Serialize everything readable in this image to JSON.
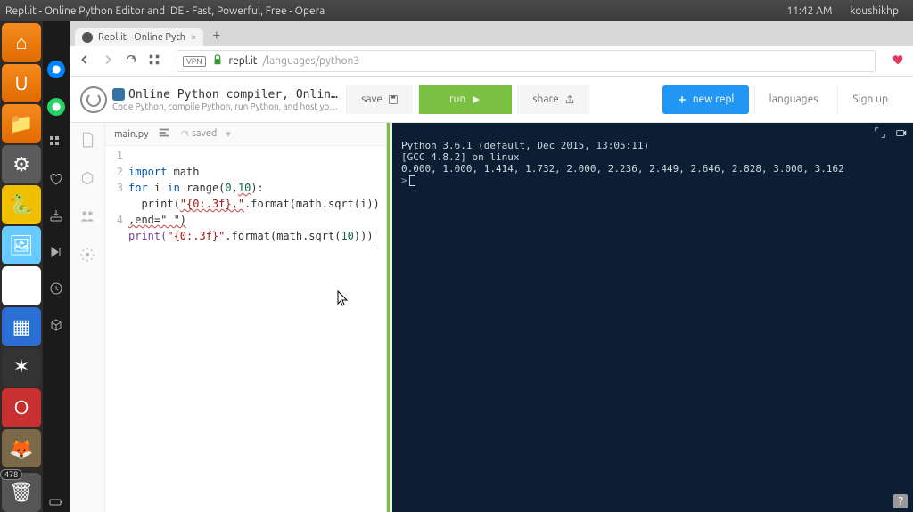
{
  "sysbar": {
    "window_title": "Repl.it - Online Python Editor and IDE - Fast, Powerful, Free - Opera",
    "clock": "11:42 AM",
    "user": "koushikhp"
  },
  "launcher": {
    "badge_count": "478"
  },
  "browser": {
    "tab_title": "Repl.it - Online Pyth",
    "url_host": "repl.it",
    "url_path": "/languages/python3"
  },
  "page": {
    "title_line": "Online Python compiler, Online Python IDE, an…",
    "subtitle": "Code Python, compile Python, run Python, and host your programs and app…",
    "buttons": {
      "save": "save",
      "run": "run",
      "share": "share",
      "newrepl": "new repl",
      "languages": "languages",
      "signup": "Sign up"
    }
  },
  "filebar": {
    "filename": "main.py",
    "saved_label": "saved"
  },
  "code": {
    "lines": [
      "1",
      "2",
      "3",
      "4"
    ],
    "l1_a": "import",
    "l1_b": " math",
    "l2_a": "for",
    "l2_b": " i ",
    "l2_c": "in",
    "l2_d": " range(",
    "l2_e": "0",
    "l2_f": ",",
    "l2_g": "10",
    "l2_h": "):",
    "l3_a": "  print(",
    "l3_b": "\"{0:.3f},\"",
    "l3_c": ".format(math.sqrt(i))",
    "l3_w": ",end=\" \")",
    "l4_a": "print(",
    "l4_b": "\"{0:.3f}\"",
    "l4_c": ".format(math.sqrt(",
    "l4_d": "10",
    "l4_e": ")))"
  },
  "console": {
    "line1": "Python 3.6.1 (default, Dec 2015, 13:05:11)",
    "line2": "[GCC 4.8.2] on linux",
    "line3": "0.000, 1.000, 1.414, 1.732, 2.000, 2.236, 2.449, 2.646, 2.828, 3.000, 3.162",
    "prompt": ">"
  }
}
